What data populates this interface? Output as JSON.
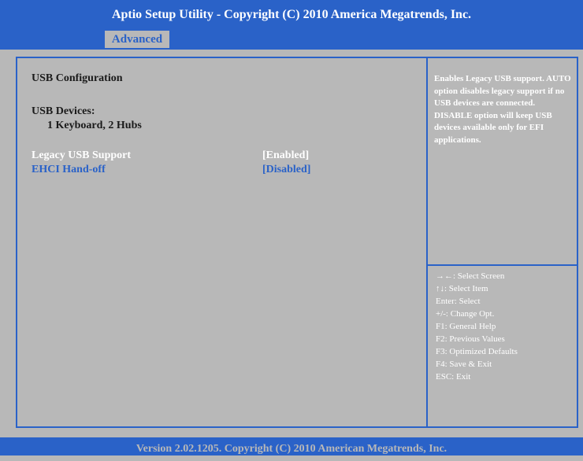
{
  "header": {
    "title": "Aptio Setup Utility - Copyright (C) 2010 America Megatrends, Inc."
  },
  "tabs": [
    {
      "label": "Advanced",
      "active": true
    }
  ],
  "main": {
    "section_title": "USB Configuration",
    "devices_label": "USB Devices:",
    "devices_value": "1 Keyboard, 2 Hubs",
    "options": [
      {
        "label": "Legacy USB Support",
        "value": "[Enabled]",
        "selected": true
      },
      {
        "label": "EHCI Hand-off",
        "value": "[Disabled]",
        "selected": false
      }
    ]
  },
  "help": {
    "description": "Enables Legacy USB support. AUTO option disables legacy support if no USB devices are connected. DISABLE option will keep USB devices available only for EFI applications."
  },
  "keys": [
    "→←: Select Screen",
    "↑↓: Select Item",
    "Enter: Select",
    "+/-: Change Opt.",
    "F1: General Help",
    "F2: Previous Values",
    "F3: Optimized Defaults",
    "F4: Save & Exit",
    "ESC: Exit"
  ],
  "footer": {
    "text": "Version 2.02.1205. Copyright (C) 2010 American Megatrends, Inc."
  },
  "colors": {
    "accent_blue": "#2a62c8",
    "background_gray": "#b8b8b8",
    "selected_text": "#ffffff"
  }
}
